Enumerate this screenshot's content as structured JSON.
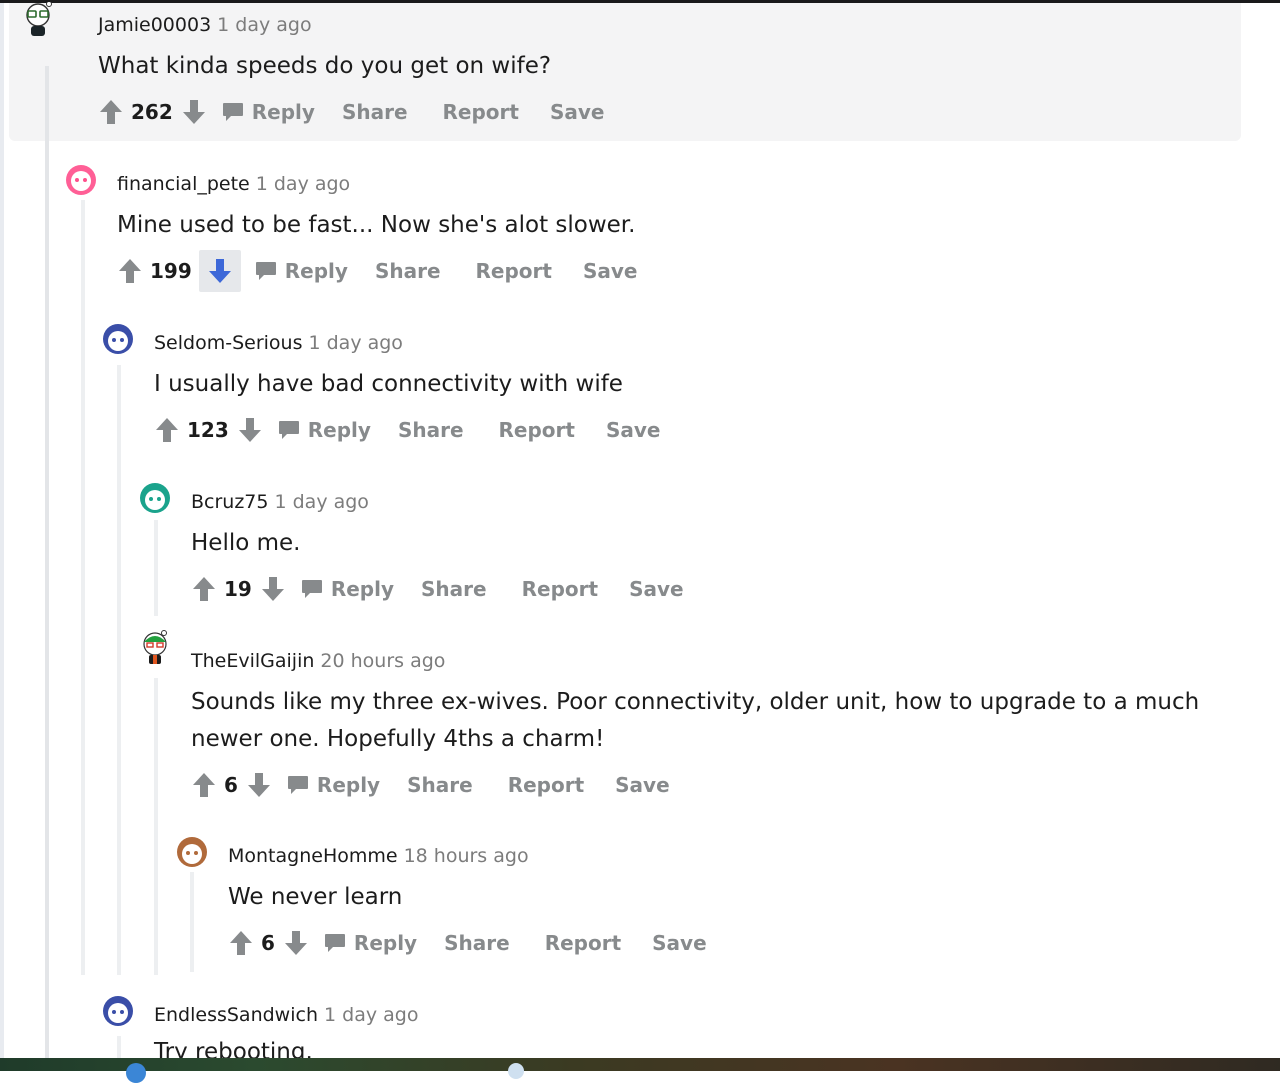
{
  "comments": [
    {
      "author": "Jamie00003",
      "time": "1 day ago",
      "body": "What kinda speeds do you get on wife?",
      "score": "262",
      "avatar_color": "#7c7c7c"
    },
    {
      "author": "financial_pete",
      "time": "1 day ago",
      "body": "Mine used to be fast... Now she's alot slower.",
      "score": "199",
      "avatar_color": "#ff4f8c",
      "downvoted": true
    },
    {
      "author": "Seldom-Serious",
      "time": "1 day ago",
      "body": "I usually have bad connectivity with wife",
      "score": "123",
      "avatar_color": "#3a4ea8"
    },
    {
      "author": "Bcruz75",
      "time": "1 day ago",
      "body": "Hello me.",
      "score": "19",
      "avatar_color": "#1aa38c"
    },
    {
      "author": "TheEvilGaijin",
      "time": "20 hours ago",
      "body_line1": "Sounds like my three ex-wives. Poor connectivity, older unit, how to upgrade to a much",
      "body_line2": "newer one. Hopefully 4ths a charm!",
      "score": "6",
      "avatar_color": "#23a03e"
    },
    {
      "author": "MontagneHomme",
      "time": "18 hours ago",
      "body": "We never learn",
      "score": "6",
      "avatar_color": "#b06a3b"
    },
    {
      "author": "EndlessSandwich",
      "time": "1 day ago",
      "body": "Try rebooting.",
      "avatar_color": "#3a4ea8"
    }
  ],
  "actions": {
    "reply": "Reply",
    "share": "Share",
    "report": "Report",
    "save": "Save"
  },
  "colors": {
    "downvote_active": "#3d68d8",
    "action_gray": "#878a8c"
  }
}
